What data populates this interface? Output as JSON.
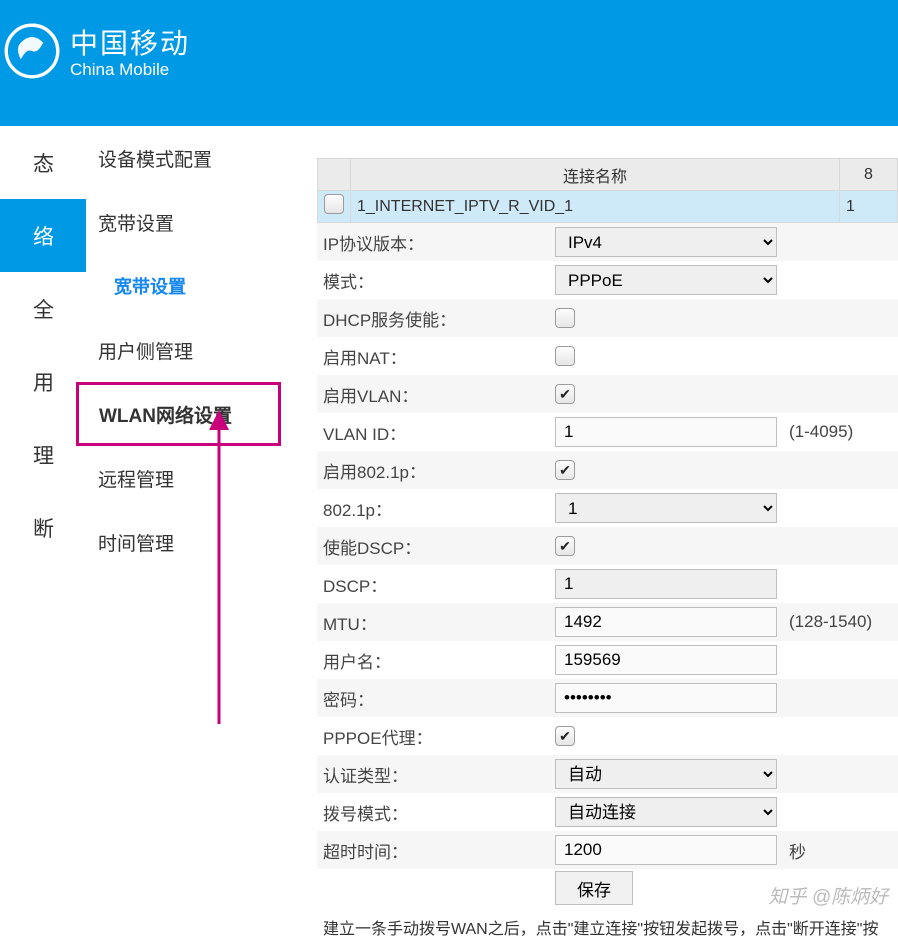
{
  "brand": {
    "cn": "中国移动",
    "en": "China Mobile"
  },
  "leftnav": [
    {
      "label": "态"
    },
    {
      "label": "络",
      "active": true
    },
    {
      "label": "全"
    },
    {
      "label": "用"
    },
    {
      "label": "理"
    },
    {
      "label": "断"
    }
  ],
  "subnav": [
    {
      "label": "设备模式配置"
    },
    {
      "label": "宽带设置"
    },
    {
      "label": "宽带设置",
      "current": true
    },
    {
      "label": "用户侧管理"
    },
    {
      "label": "WLAN网络设置",
      "highlighted": true
    },
    {
      "label": "远程管理"
    },
    {
      "label": "时间管理"
    }
  ],
  "table": {
    "col_conn": "连接名称",
    "col_8": "8",
    "row_conn_name": "1_INTERNET_IPTV_R_VID_1",
    "row_8": "1"
  },
  "labels": {
    "ip_ver": "IP协议版本：",
    "mode": "模式：",
    "dhcp": "DHCP服务使能：",
    "nat": "启用NAT：",
    "vlan": "启用VLAN：",
    "vlan_id": "VLAN ID：",
    "8021p_en": "启用802.1p：",
    "8021p": "802.1p：",
    "dscp_en": "使能DSCP：",
    "dscp": "DSCP：",
    "mtu": "MTU：",
    "user": "用户名：",
    "pwd": "密码：",
    "pppoe_proxy": "PPPOE代理：",
    "auth": "认证类型：",
    "dial": "拨号模式：",
    "timeout": "超时时间：",
    "save": "保存"
  },
  "values": {
    "ip_ver": "IPv4",
    "mode": "PPPoE",
    "dhcp": false,
    "nat": false,
    "vlan": true,
    "vlan_id": "1",
    "vlan_id_hint": "(1-4095)",
    "8021p_en": true,
    "8021p": "1",
    "dscp_en": true,
    "dscp": "1",
    "mtu": "1492",
    "mtu_hint": "(128-1540)",
    "user": "159569",
    "pwd": "••••••••",
    "pppoe_proxy": true,
    "auth": "自动",
    "dial": "自动连接",
    "timeout": "1200",
    "timeout_unit": "秒"
  },
  "footnote": "建立一条手动拨号WAN之后，点击\"建立连接\"按钮发起拨号，点击\"断开连接\"按",
  "watermark": "知乎  @陈炳好"
}
